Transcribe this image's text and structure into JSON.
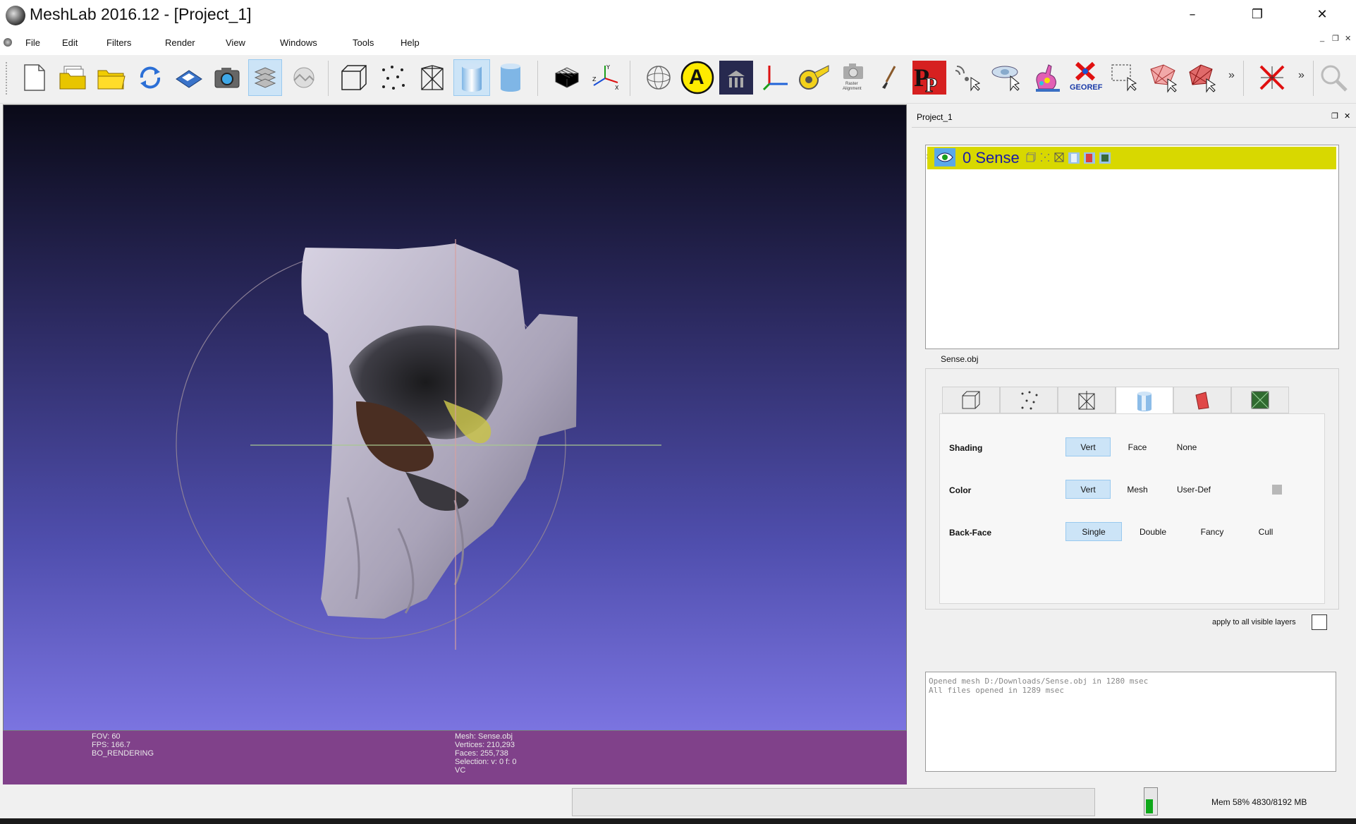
{
  "window": {
    "title": "MeshLab 2016.12 - [Project_1]",
    "minimize": "–",
    "restore": "❐",
    "close": "✕"
  },
  "menu": [
    "File",
    "Edit",
    "Filters",
    "Render",
    "View",
    "Windows",
    "Tools",
    "Help"
  ],
  "mdi_controls": [
    "_",
    "❐",
    "✕"
  ],
  "toolbar": {
    "georef_label": "GEOREF",
    "raster_label_1": "Raster",
    "raster_label_2": "Alignment",
    "annotation_letter": "A",
    "overflow": "»"
  },
  "viewport": {
    "info_left": [
      "FOV: 60",
      "FPS:   166.7",
      "BO_RENDERING"
    ],
    "info_right": [
      "Mesh: Sense.obj",
      "Vertices: 210,293",
      "Faces: 255,738",
      "Selection: v: 0 f: 0",
      "VC"
    ]
  },
  "dock": {
    "title": "Project_1",
    "float_icon": "❐",
    "close_icon": "✕",
    "layer": {
      "name": "0 Sense"
    },
    "decor_title": "Sense.obj",
    "shading": {
      "label": "Shading",
      "options": [
        "Vert",
        "Face",
        "None"
      ],
      "selected": "Vert"
    },
    "color": {
      "label": "Color",
      "options": [
        "Vert",
        "Mesh",
        "User-Def"
      ],
      "selected": "Vert",
      "swatch": "#b8b8b8"
    },
    "backface": {
      "label": "Back-Face",
      "options": [
        "Single",
        "Double",
        "Fancy",
        "Cull"
      ],
      "selected": "Single"
    },
    "apply_all": "apply to all visible layers",
    "log": [
      "Opened mesh D:/Downloads/Sense.obj in 1280 msec",
      "All files opened in 1289 msec"
    ]
  },
  "status": {
    "memory": "Mem 58% 4830/8192 MB",
    "memory_usage_fraction": 0.58
  },
  "colors": {
    "layer_highlight": "#d8d800",
    "info_bar": "#80418a",
    "selected_button": "#cce4f7"
  }
}
